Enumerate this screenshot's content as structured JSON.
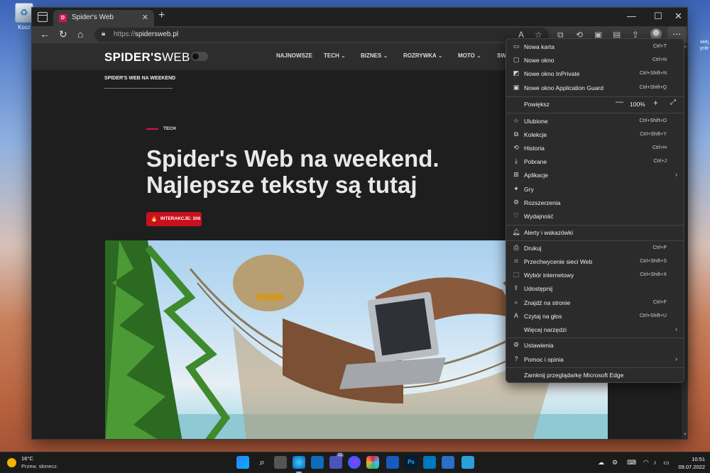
{
  "desktop": {
    "recycle_bin_label": "Kosz",
    "side_text": "wiej\nycle"
  },
  "browser": {
    "tab": {
      "title": "Spider's Web",
      "favicon_letter": "D"
    },
    "address": {
      "protocol": "https://",
      "host": "spidersweb.pl"
    },
    "window_controls": [
      "—",
      "☐",
      "✕"
    ]
  },
  "site": {
    "logo_bold": "SPIDER'S",
    "logo_thin": "WEB",
    "nav": [
      "NAJNOWSZE",
      "TECH",
      "BIZNES",
      "ROZRYWKA",
      "MOTO",
      "SW"
    ],
    "subnav": "SPIDER'S WEB NA WEEKEND",
    "category": "TECH",
    "headline_line1": "Spider's Web na weekend.",
    "headline_line2": "Najlepsze teksty są tutaj",
    "badge": "INTERAKCJE: 206"
  },
  "menu": {
    "items": [
      {
        "icon": "new-tab-icon",
        "label": "Nowa karta",
        "shortcut": "Ctrl+T"
      },
      {
        "icon": "new-window-icon",
        "label": "Nowe okno",
        "shortcut": "Ctrl+N"
      },
      {
        "icon": "inprivate-icon",
        "label": "Nowe okno InPrivate",
        "shortcut": "Ctrl+Shift+N"
      },
      {
        "icon": "app-guard-icon",
        "label": "Nowe okno Application Guard",
        "shortcut": "Ctrl+Shift+Q"
      },
      {
        "icon": "",
        "label": "Powiększ",
        "shortcut": ""
      },
      {
        "icon": "favorites-icon",
        "label": "Ulubione",
        "shortcut": "Ctrl+Shift+O"
      },
      {
        "icon": "collections-icon",
        "label": "Kolekcje",
        "shortcut": "Ctrl+Shift+Y"
      },
      {
        "icon": "history-icon",
        "label": "Historia",
        "shortcut": "Ctrl+H"
      },
      {
        "icon": "downloads-icon",
        "label": "Pobrane",
        "shortcut": "Ctrl+J"
      },
      {
        "icon": "apps-icon",
        "label": "Aplikacje",
        "shortcut": ""
      },
      {
        "icon": "games-icon",
        "label": "Gry",
        "shortcut": ""
      },
      {
        "icon": "extensions-icon",
        "label": "Rozszerzenia",
        "shortcut": ""
      },
      {
        "icon": "performance-icon",
        "label": "Wydajność",
        "shortcut": ""
      },
      {
        "icon": "alerts-icon",
        "label": "Alerty i wskazówki",
        "shortcut": ""
      },
      {
        "icon": "print-icon",
        "label": "Drukuj",
        "shortcut": "Ctrl+P"
      },
      {
        "icon": "web-capture-icon",
        "label": "Przechwycenie sieci Web",
        "shortcut": "Ctrl+Shift+S"
      },
      {
        "icon": "web-select-icon",
        "label": "Wybór internetowy",
        "shortcut": "Ctrl+Shift+X"
      },
      {
        "icon": "share-icon",
        "label": "Udostępnij",
        "shortcut": ""
      },
      {
        "icon": "find-icon",
        "label": "Znajdź na stronie",
        "shortcut": "Ctrl+F"
      },
      {
        "icon": "read-aloud-icon",
        "label": "Czytaj na głos",
        "shortcut": "Ctrl+Shift+U"
      },
      {
        "icon": "",
        "label": "Więcej narzędzi",
        "shortcut": ""
      },
      {
        "icon": "settings-icon",
        "label": "Ustawienia",
        "shortcut": ""
      },
      {
        "icon": "help-icon",
        "label": "Pomoc i opinia",
        "shortcut": ""
      },
      {
        "icon": "",
        "label": "Zamknij przeglądarkę Microsoft Edge",
        "shortcut": ""
      }
    ],
    "zoom_value": "100%"
  },
  "taskbar": {
    "weather_temp": "16°C",
    "weather_desc": "Przew. słonecz.",
    "teams_badge": "11",
    "time": "10:51",
    "date": "09.07.2022"
  }
}
